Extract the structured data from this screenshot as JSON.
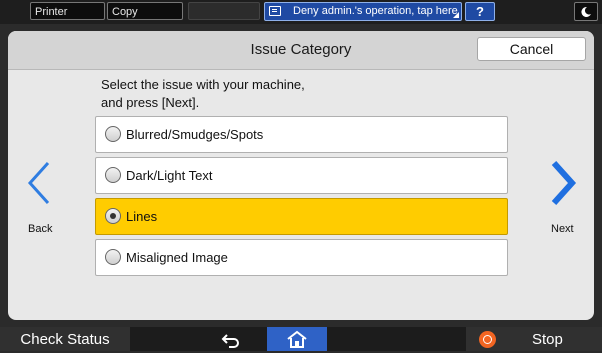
{
  "topbar": {
    "printer_label": "Printer",
    "copy_label": "Copy",
    "deny_label": "Deny admin.'s operation, tap here",
    "help_label": "?",
    "moon_icon": "moon-icon"
  },
  "dialog": {
    "title": "Issue Category",
    "cancel_label": "Cancel",
    "instruction_line1": "Select the issue with your machine,",
    "instruction_line2": "and press [Next].",
    "options": [
      {
        "label": "Blurred/Smudges/Spots",
        "selected": false
      },
      {
        "label": "Dark/Light Text",
        "selected": false
      },
      {
        "label": "Lines",
        "selected": true
      },
      {
        "label": "Misaligned Image",
        "selected": false
      }
    ],
    "back_label": "Back",
    "next_label": "Next"
  },
  "bottombar": {
    "check_status_label": "Check Status",
    "stop_label": "Stop"
  },
  "colors": {
    "selected": "#ffcc00",
    "accent_blue": "#2f62c6",
    "stop_orange": "#f26522"
  }
}
